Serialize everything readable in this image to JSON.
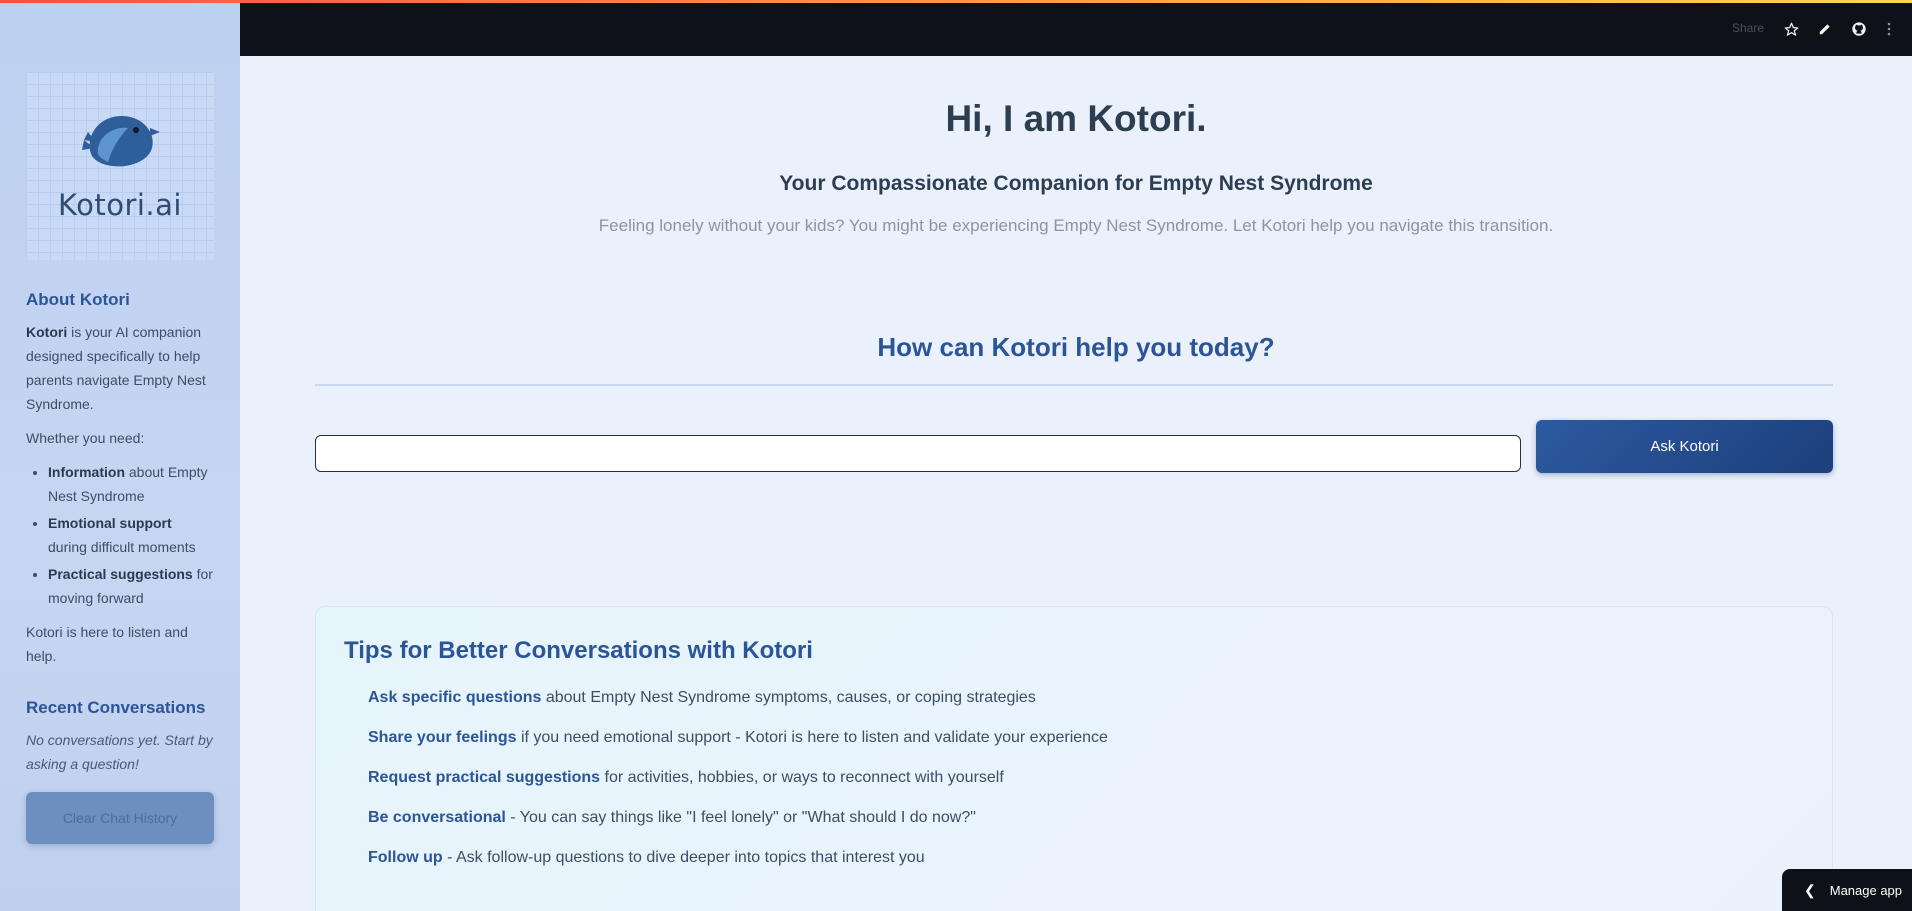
{
  "header": {
    "share_label": "Share",
    "icons": [
      "star-icon",
      "edit-pencil-icon",
      "github-icon",
      "more-vertical-icon"
    ]
  },
  "sidebar": {
    "logo_text": "Kotori.ai",
    "about_heading": "About Kotori",
    "about_name": "Kotori",
    "about_text": " is your AI companion designed specifically to help parents navigate Empty Nest Syndrome.",
    "whether_text": "Whether you need:",
    "items": [
      {
        "bold": "Information",
        "text": " about Empty Nest Syndrome"
      },
      {
        "bold": "Emotional support",
        "text": " during difficult moments"
      },
      {
        "bold": "Practical suggestions",
        "text": " for moving forward"
      }
    ],
    "closing_text": "Kotori is here to listen and help.",
    "recent_heading": "Recent Conversations",
    "recent_empty": "No conversations yet. Start by asking a question!",
    "clear_button": "Clear Chat History"
  },
  "main": {
    "title": "Hi, I am Kotori.",
    "subtitle": "Your Compassionate Companion for Empty Nest Syndrome",
    "tagline": "Feeling lonely without your kids? You might be experiencing Empty Nest Syndrome. Let Kotori help you navigate this transition.",
    "help_heading": "How can Kotori help you today?",
    "input_value": "",
    "ask_button": "Ask Kotori"
  },
  "tips": {
    "heading": "Tips for Better Conversations with Kotori",
    "items": [
      {
        "key": "Ask specific questions",
        "text": " about Empty Nest Syndrome symptoms, causes, or coping strategies"
      },
      {
        "key": "Share your feelings",
        "text": " if you need emotional support - Kotori is here to listen and validate your experience"
      },
      {
        "key": "Request practical suggestions",
        "text": " for activities, hobbies, or ways to reconnect with yourself"
      },
      {
        "key": "Be conversational",
        "text": " - You can say things like \"I feel lonely\" or \"What should I do now?\""
      },
      {
        "key": "Follow up",
        "text": " - Ask follow-up questions to dive deeper into topics that interest you"
      }
    ]
  },
  "footer": {
    "manage_label": "Manage app"
  },
  "colors": {
    "accent": "#2b5597",
    "button": "#2d5aa0",
    "header_bg": "#0e1117"
  }
}
